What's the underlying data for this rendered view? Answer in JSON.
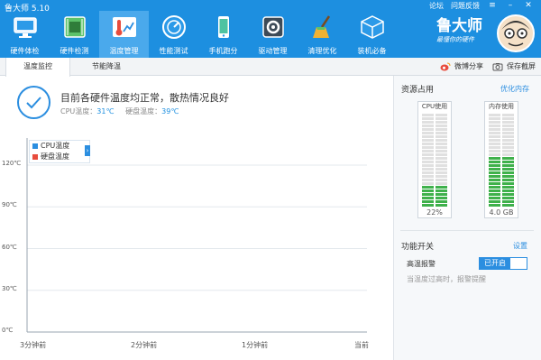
{
  "app": {
    "title": "鲁大师 5.10"
  },
  "window_links": {
    "forum": "论坛",
    "feedback": "问题反馈"
  },
  "nav": [
    {
      "label": "硬件体检",
      "icon": "monitor-icon"
    },
    {
      "label": "硬件检测",
      "icon": "circuit-board-icon"
    },
    {
      "label": "温度管理",
      "icon": "thermometer-icon"
    },
    {
      "label": "性能测试",
      "icon": "speedometer-icon"
    },
    {
      "label": "手机跑分",
      "icon": "smartphone-icon"
    },
    {
      "label": "驱动管理",
      "icon": "gear-chip-icon"
    },
    {
      "label": "清理优化",
      "icon": "broom-icon"
    },
    {
      "label": "装机必备",
      "icon": "package-box-icon"
    }
  ],
  "brand": {
    "name": "鲁大师",
    "slogan": "最懂你的硬件"
  },
  "tabs": [
    {
      "label": "温度监控",
      "active": true
    },
    {
      "label": "节能降温",
      "active": false
    }
  ],
  "actions": {
    "share": "微博分享",
    "screenshot": "保存截屏"
  },
  "status": {
    "message": "目前各硬件温度均正常，散热情况良好",
    "cpu_label": "CPU温度：",
    "cpu_value": "31℃",
    "disk_label": "硬盘温度：",
    "disk_value": "39℃"
  },
  "legend": [
    {
      "label": "CPU温度",
      "color": "#2b8ee0"
    },
    {
      "label": "硬盘温度",
      "color": "#e84c3d"
    }
  ],
  "chart_data": {
    "type": "line",
    "y_ticks": [
      "120℃",
      "90℃",
      "60℃",
      "30℃",
      "0℃"
    ],
    "x_ticks": [
      "3分钟前",
      "2分钟前",
      "1分钟前",
      "当前"
    ],
    "ylim": [
      0,
      120
    ],
    "series": [
      {
        "name": "CPU温度",
        "values": []
      },
      {
        "name": "硬盘温度",
        "values": []
      }
    ],
    "grid": true
  },
  "resources": {
    "title": "资源占用",
    "optimize_link": "优化内存",
    "cpu": {
      "label": "CPU使用",
      "value": "22%",
      "fraction": 0.22
    },
    "memory": {
      "label": "内存使用",
      "value": "4.0 GB",
      "fraction": 0.53
    }
  },
  "features": {
    "title": "功能开关",
    "settings_link": "设置",
    "alarm_label": "高温报警",
    "alarm_state": "已开启",
    "alarm_hint": "当温度过高时，报警提醒"
  },
  "colors": {
    "accent": "#1d8fe0",
    "meter_fill": "#3fb14b",
    "meter_empty": "#e0e0e0"
  }
}
